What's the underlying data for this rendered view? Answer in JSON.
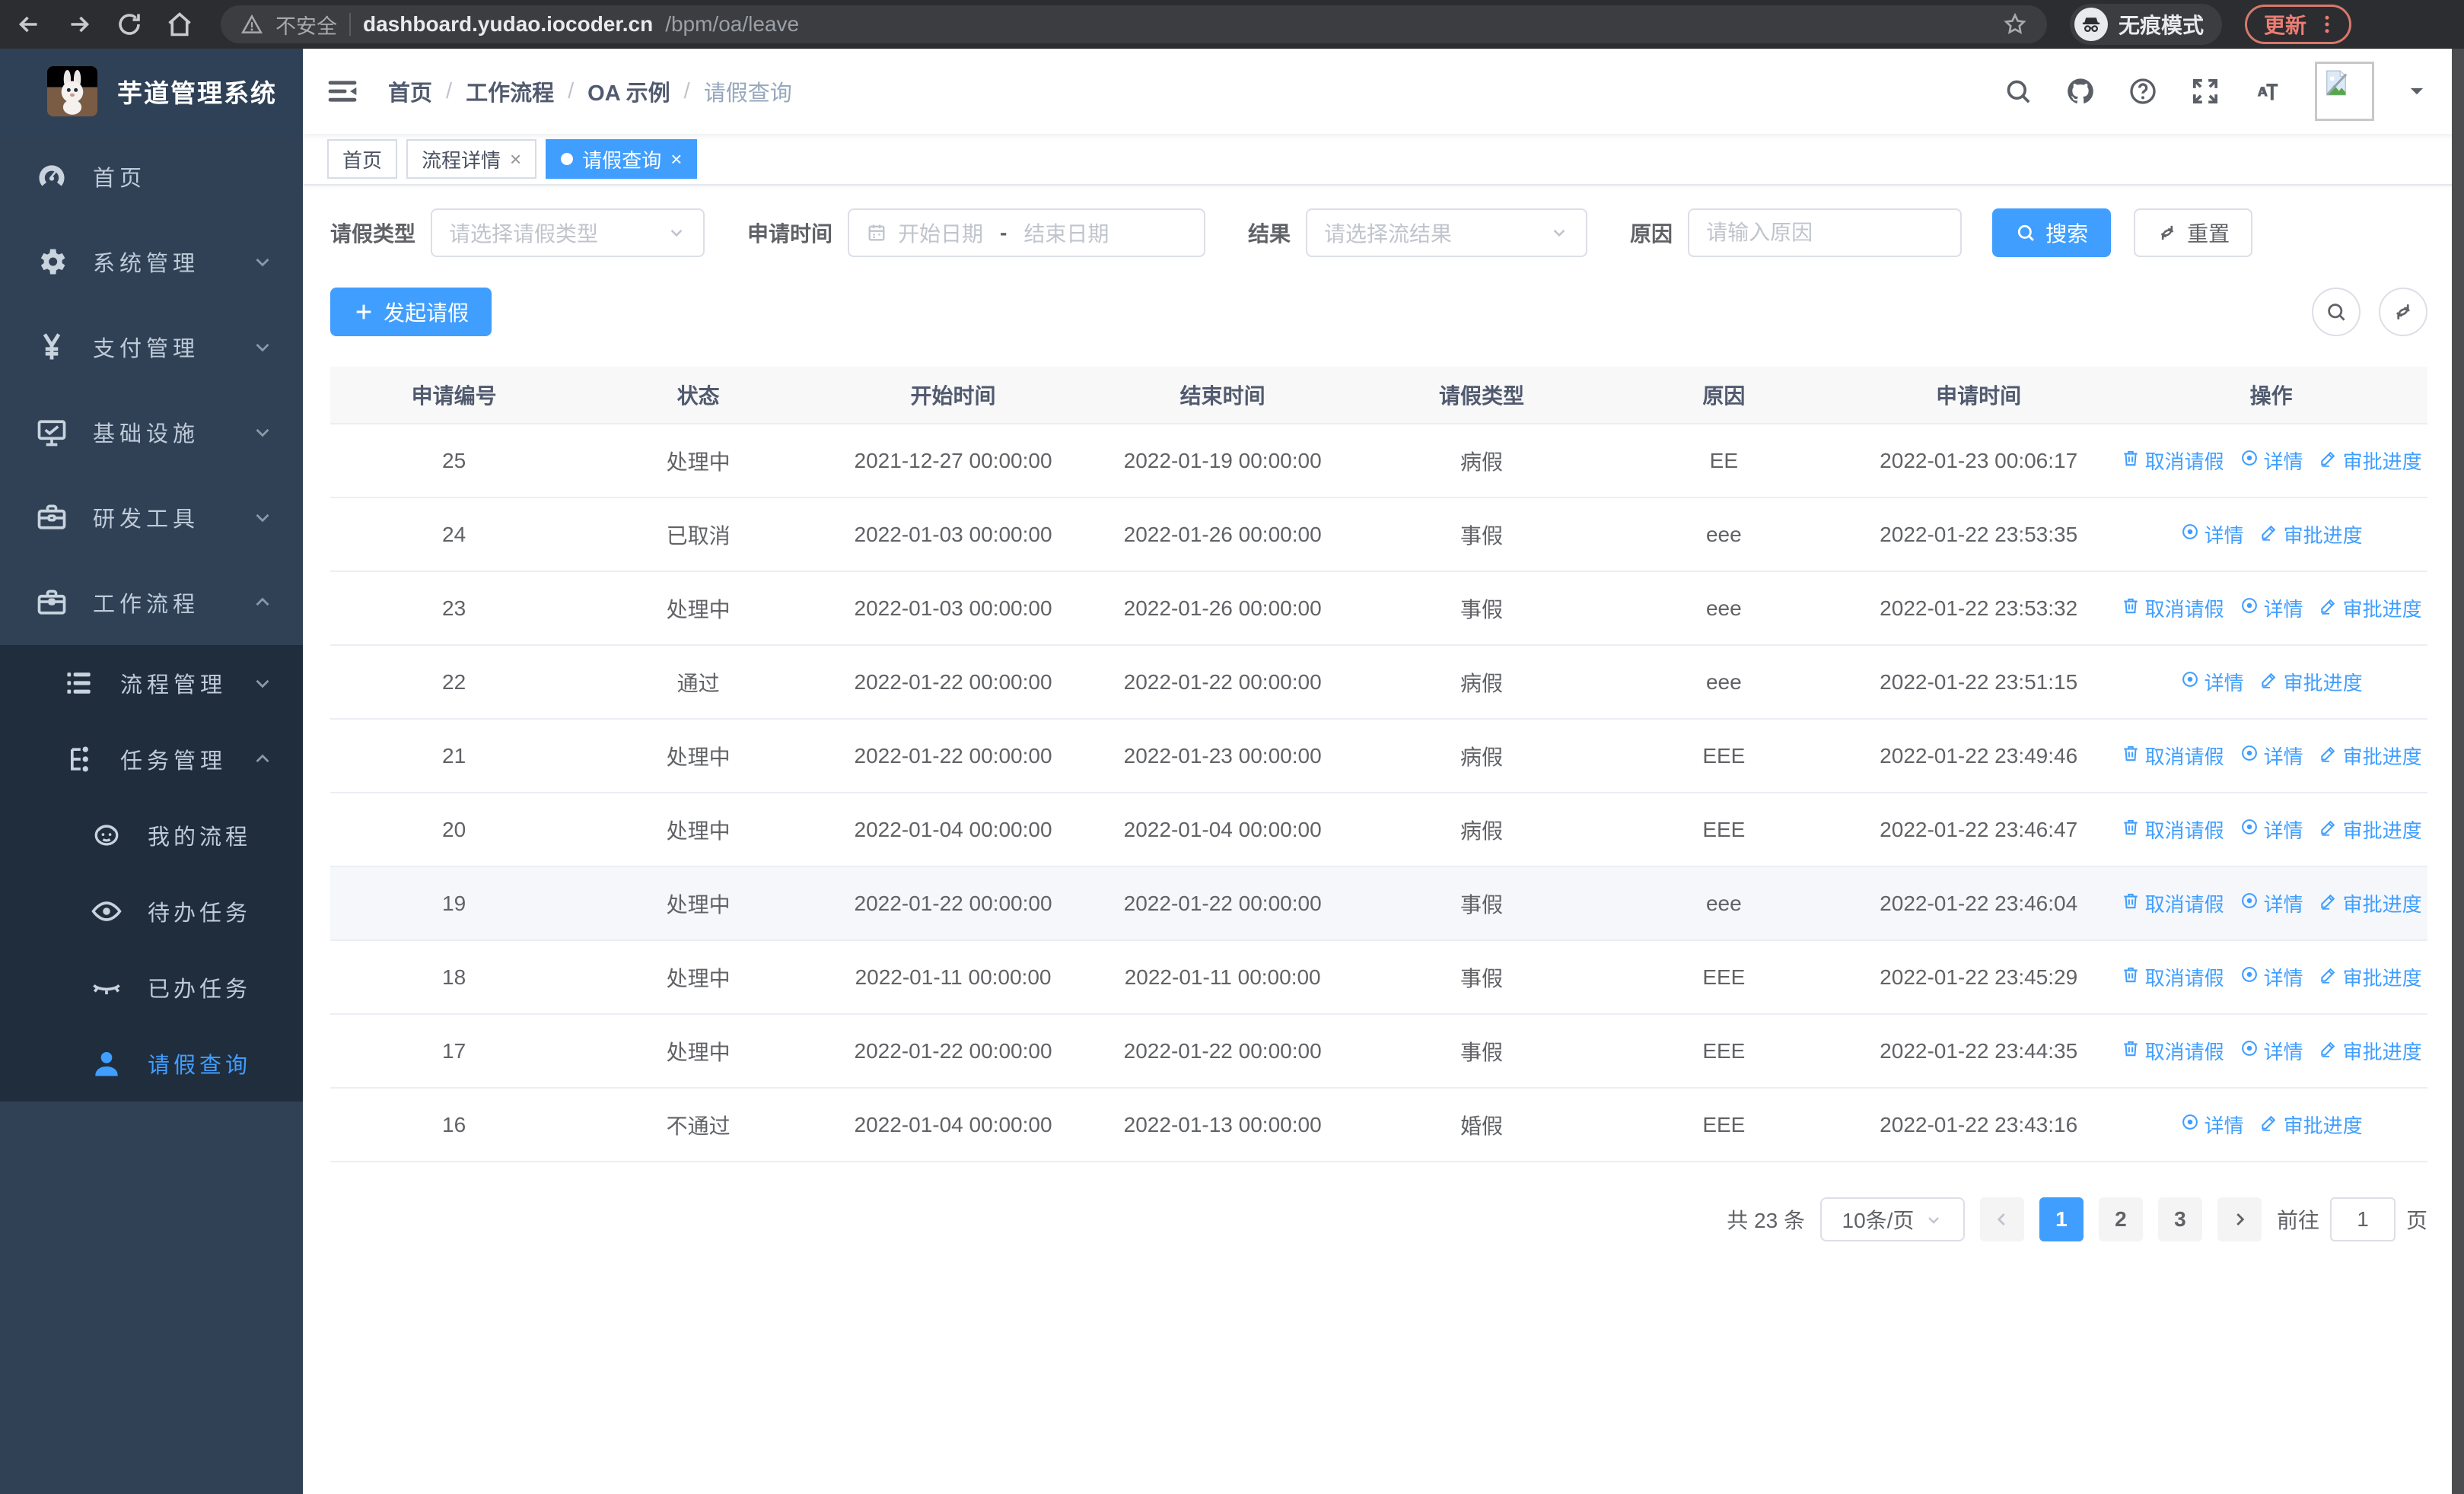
{
  "browser": {
    "not_secure": "不安全",
    "url_host": "dashboard.yudao.iocoder.cn",
    "url_path": "/bpm/oa/leave",
    "incognito": "无痕模式",
    "update": "更新"
  },
  "sidebar": {
    "title": "芋道管理系统",
    "menu": [
      {
        "label": "首页",
        "icon": "dashboard-icon",
        "chevron": "none",
        "active": false
      },
      {
        "label": "系统管理",
        "icon": "gear-icon",
        "chevron": "down",
        "active": false
      },
      {
        "label": "支付管理",
        "icon": "yen-icon",
        "chevron": "down",
        "active": false
      },
      {
        "label": "基础设施",
        "icon": "monitor-icon",
        "chevron": "down",
        "active": false
      },
      {
        "label": "研发工具",
        "icon": "toolbox-icon",
        "chevron": "down",
        "active": false
      },
      {
        "label": "工作流程",
        "icon": "briefcase-icon",
        "chevron": "up",
        "active": false
      }
    ],
    "submenu": [
      {
        "label": "流程管理",
        "icon": "list-icon",
        "level": 1,
        "chevron": "down",
        "active": false
      },
      {
        "label": "任务管理",
        "icon": "flow-icon",
        "level": 1,
        "chevron": "up",
        "active": false
      },
      {
        "label": "我的流程",
        "icon": "robot-icon",
        "level": 2,
        "chevron": "none",
        "active": false
      },
      {
        "label": "待办任务",
        "icon": "eye-open-icon",
        "level": 2,
        "chevron": "none",
        "active": false
      },
      {
        "label": "已办任务",
        "icon": "eye-closed-icon",
        "level": 2,
        "chevron": "none",
        "active": false
      },
      {
        "label": "请假查询",
        "icon": "user-icon",
        "level": 2,
        "chevron": "none",
        "active": true
      }
    ]
  },
  "header": {
    "breadcrumb": [
      "首页",
      "工作流程",
      "OA 示例",
      "请假查询"
    ]
  },
  "tabs": [
    {
      "label": "首页",
      "closable": false,
      "active": false
    },
    {
      "label": "流程详情",
      "closable": true,
      "active": false
    },
    {
      "label": "请假查询",
      "closable": true,
      "active": true
    }
  ],
  "filters": {
    "type_label": "请假类型",
    "type_placeholder": "请选择请假类型",
    "time_label": "申请时间",
    "start_placeholder": "开始日期",
    "range_separator": "-",
    "end_placeholder": "结束日期",
    "result_label": "结果",
    "result_placeholder": "请选择流结果",
    "reason_label": "原因",
    "reason_placeholder": "请输入原因",
    "search_label": "搜索",
    "reset_label": "重置"
  },
  "toolbar": {
    "create_label": "发起请假"
  },
  "table": {
    "columns": [
      "申请编号",
      "状态",
      "开始时间",
      "结束时间",
      "请假类型",
      "原因",
      "申请时间",
      "操作"
    ],
    "action_labels": {
      "cancel": "取消请假",
      "detail": "详情",
      "progress": "审批进度"
    },
    "rows": [
      {
        "id": "25",
        "status": "处理中",
        "start": "2021-12-27 00:00:00",
        "end": "2022-01-19 00:00:00",
        "type": "病假",
        "reason": "EE",
        "applied": "2022-01-23 00:06:17",
        "cancelable": true,
        "highlight": false
      },
      {
        "id": "24",
        "status": "已取消",
        "start": "2022-01-03 00:00:00",
        "end": "2022-01-26 00:00:00",
        "type": "事假",
        "reason": "eee",
        "applied": "2022-01-22 23:53:35",
        "cancelable": false,
        "highlight": false
      },
      {
        "id": "23",
        "status": "处理中",
        "start": "2022-01-03 00:00:00",
        "end": "2022-01-26 00:00:00",
        "type": "事假",
        "reason": "eee",
        "applied": "2022-01-22 23:53:32",
        "cancelable": true,
        "highlight": false
      },
      {
        "id": "22",
        "status": "通过",
        "start": "2022-01-22 00:00:00",
        "end": "2022-01-22 00:00:00",
        "type": "病假",
        "reason": "eee",
        "applied": "2022-01-22 23:51:15",
        "cancelable": false,
        "highlight": false
      },
      {
        "id": "21",
        "status": "处理中",
        "start": "2022-01-22 00:00:00",
        "end": "2022-01-23 00:00:00",
        "type": "病假",
        "reason": "EEE",
        "applied": "2022-01-22 23:49:46",
        "cancelable": true,
        "highlight": false
      },
      {
        "id": "20",
        "status": "处理中",
        "start": "2022-01-04 00:00:00",
        "end": "2022-01-04 00:00:00",
        "type": "病假",
        "reason": "EEE",
        "applied": "2022-01-22 23:46:47",
        "cancelable": true,
        "highlight": false
      },
      {
        "id": "19",
        "status": "处理中",
        "start": "2022-01-22 00:00:00",
        "end": "2022-01-22 00:00:00",
        "type": "事假",
        "reason": "eee",
        "applied": "2022-01-22 23:46:04",
        "cancelable": true,
        "highlight": true
      },
      {
        "id": "18",
        "status": "处理中",
        "start": "2022-01-11 00:00:00",
        "end": "2022-01-11 00:00:00",
        "type": "事假",
        "reason": "EEE",
        "applied": "2022-01-22 23:45:29",
        "cancelable": true,
        "highlight": false
      },
      {
        "id": "17",
        "status": "处理中",
        "start": "2022-01-22 00:00:00",
        "end": "2022-01-22 00:00:00",
        "type": "事假",
        "reason": "EEE",
        "applied": "2022-01-22 23:44:35",
        "cancelable": true,
        "highlight": false
      },
      {
        "id": "16",
        "status": "不通过",
        "start": "2022-01-04 00:00:00",
        "end": "2022-01-13 00:00:00",
        "type": "婚假",
        "reason": "EEE",
        "applied": "2022-01-22 23:43:16",
        "cancelable": false,
        "highlight": false
      }
    ]
  },
  "pagination": {
    "total_label": "共 23 条",
    "page_size_label": "10条/页",
    "pages": [
      "1",
      "2",
      "3"
    ],
    "current_page": "1",
    "goto_prefix": "前往",
    "goto_value": "1",
    "goto_suffix": "页"
  },
  "colors": {
    "primary": "#409eff",
    "sidebar_bg": "#304156",
    "submenu_bg": "#1f2d3d"
  }
}
